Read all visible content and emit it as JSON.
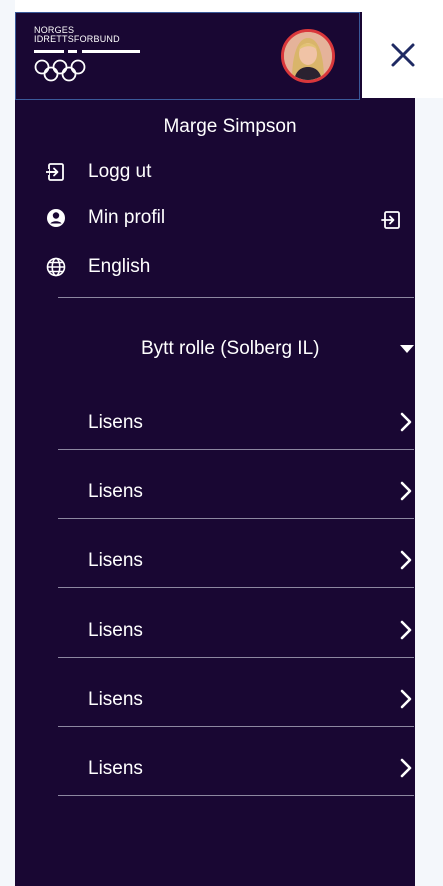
{
  "header": {
    "logo": {
      "line1": "NORGES",
      "line2": "IDRETTSFORBUND",
      "emblem": "olympic-rings-icon"
    },
    "avatar": {
      "icon": "user-avatar-photo",
      "ring_color": "#d9373b"
    },
    "close_icon": "close-icon"
  },
  "user": {
    "name": "Marge Simpson"
  },
  "menu": [
    {
      "label": "Logg ut",
      "icon": "logout-icon"
    },
    {
      "label": "Min profil",
      "icon": "user-circle-icon"
    },
    {
      "label": "English",
      "icon": "globe-icon"
    }
  ],
  "role_switch": {
    "label": "Bytt rolle (Solberg IL)",
    "icon": "caret-down-icon"
  },
  "items": [
    {
      "label": "Lisens"
    },
    {
      "label": "Lisens"
    },
    {
      "label": "Lisens"
    },
    {
      "label": "Lisens"
    },
    {
      "label": "Lisens"
    },
    {
      "label": "Lisens"
    }
  ],
  "colors": {
    "panel_bg": "#190733",
    "text": "#ffffff",
    "close_icon": "#1f2a63",
    "divider": "#8c87a0"
  }
}
